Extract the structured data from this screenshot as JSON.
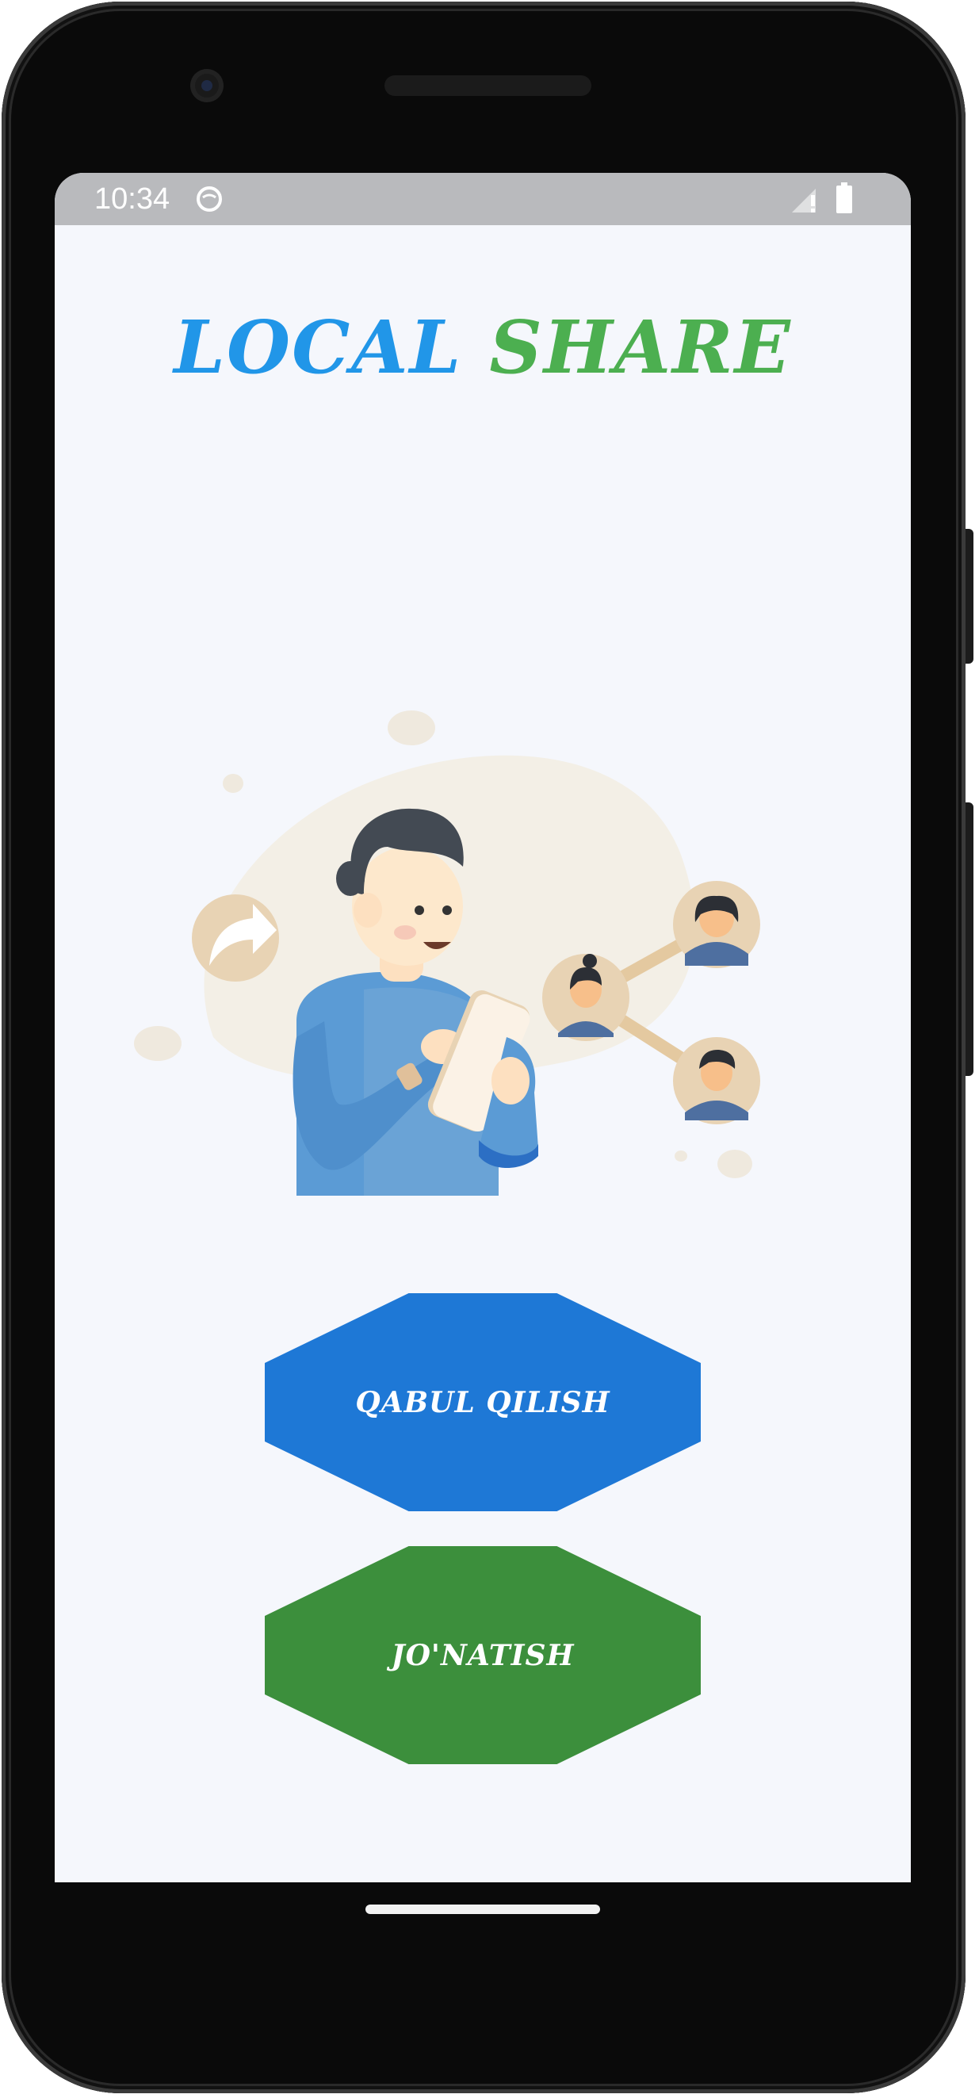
{
  "status_bar": {
    "time": "10:34",
    "icons": [
      "app-notification-icon",
      "signal-icon",
      "battery-icon"
    ]
  },
  "app": {
    "title_part1": "LOCAL",
    "title_part2": "SHARE",
    "title_colors": {
      "local": "#2196e8",
      "share": "#4caf50"
    }
  },
  "illustration": {
    "subject": "person-sharing-with-contacts-illustration"
  },
  "buttons": {
    "receive_label": "QABUL QILISH",
    "send_label": "JO'NATISH",
    "receive_color": "#1e78d6",
    "send_color": "#3c8f3c"
  },
  "colors": {
    "screen_background": "#f5f7fc",
    "status_bar": "#b9babd"
  }
}
